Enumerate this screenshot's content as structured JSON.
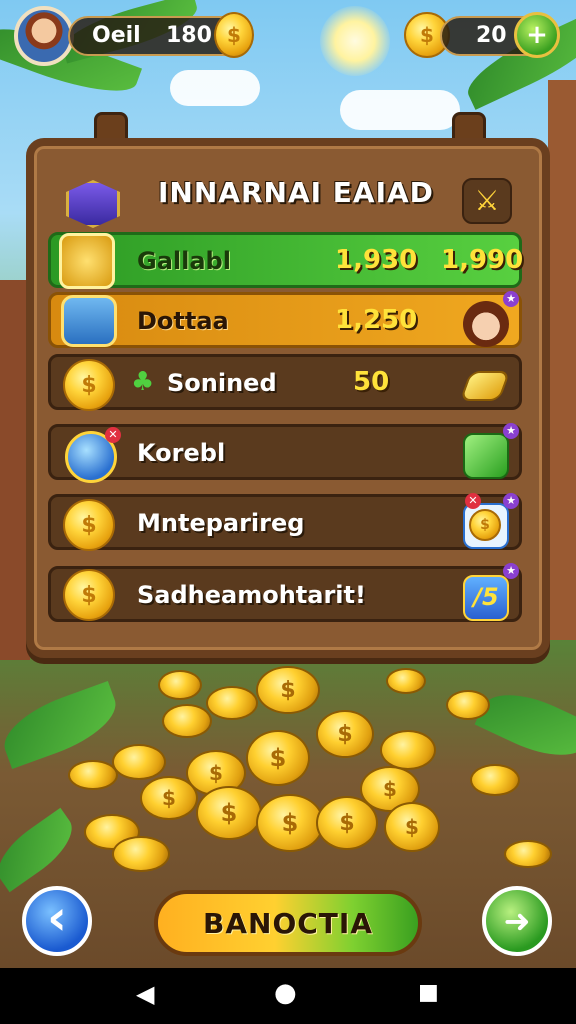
{
  "hud": {
    "left_label": "Oeil",
    "left_value": "180",
    "right_value": "20",
    "coin_glyph": "$",
    "add_glyph": "+"
  },
  "board": {
    "title": "INNARNAI EAIAD",
    "rows": [
      {
        "name": "Gallabl",
        "value": "1,930",
        "value2": "1,990",
        "color": "#3cb030"
      },
      {
        "name": "Dottaa",
        "value": "1,250",
        "color": "#e89a18"
      },
      {
        "name": "Sonined",
        "value": "50",
        "color": "#5a3a1e"
      },
      {
        "name": "Korebl",
        "color": "#5a3a1e"
      },
      {
        "name": "Mnteparireg",
        "color": "#5a3a1e"
      },
      {
        "name": "Sadheamohtarit!",
        "end_value": "/5",
        "color": "#5a3a1e"
      }
    ]
  },
  "footer": {
    "main_button": "BANOCTIA",
    "back_glyph": "‹",
    "next_glyph": "➜"
  },
  "system_nav": {
    "back": "◀",
    "home": "●",
    "recents": "■"
  },
  "colors": {
    "wood": "#8a5a32",
    "gold": "#ffd43a",
    "green": "#3cb030",
    "orange": "#e89a18",
    "blue_button": "#2a7ae8",
    "green_button": "#3ab030"
  }
}
